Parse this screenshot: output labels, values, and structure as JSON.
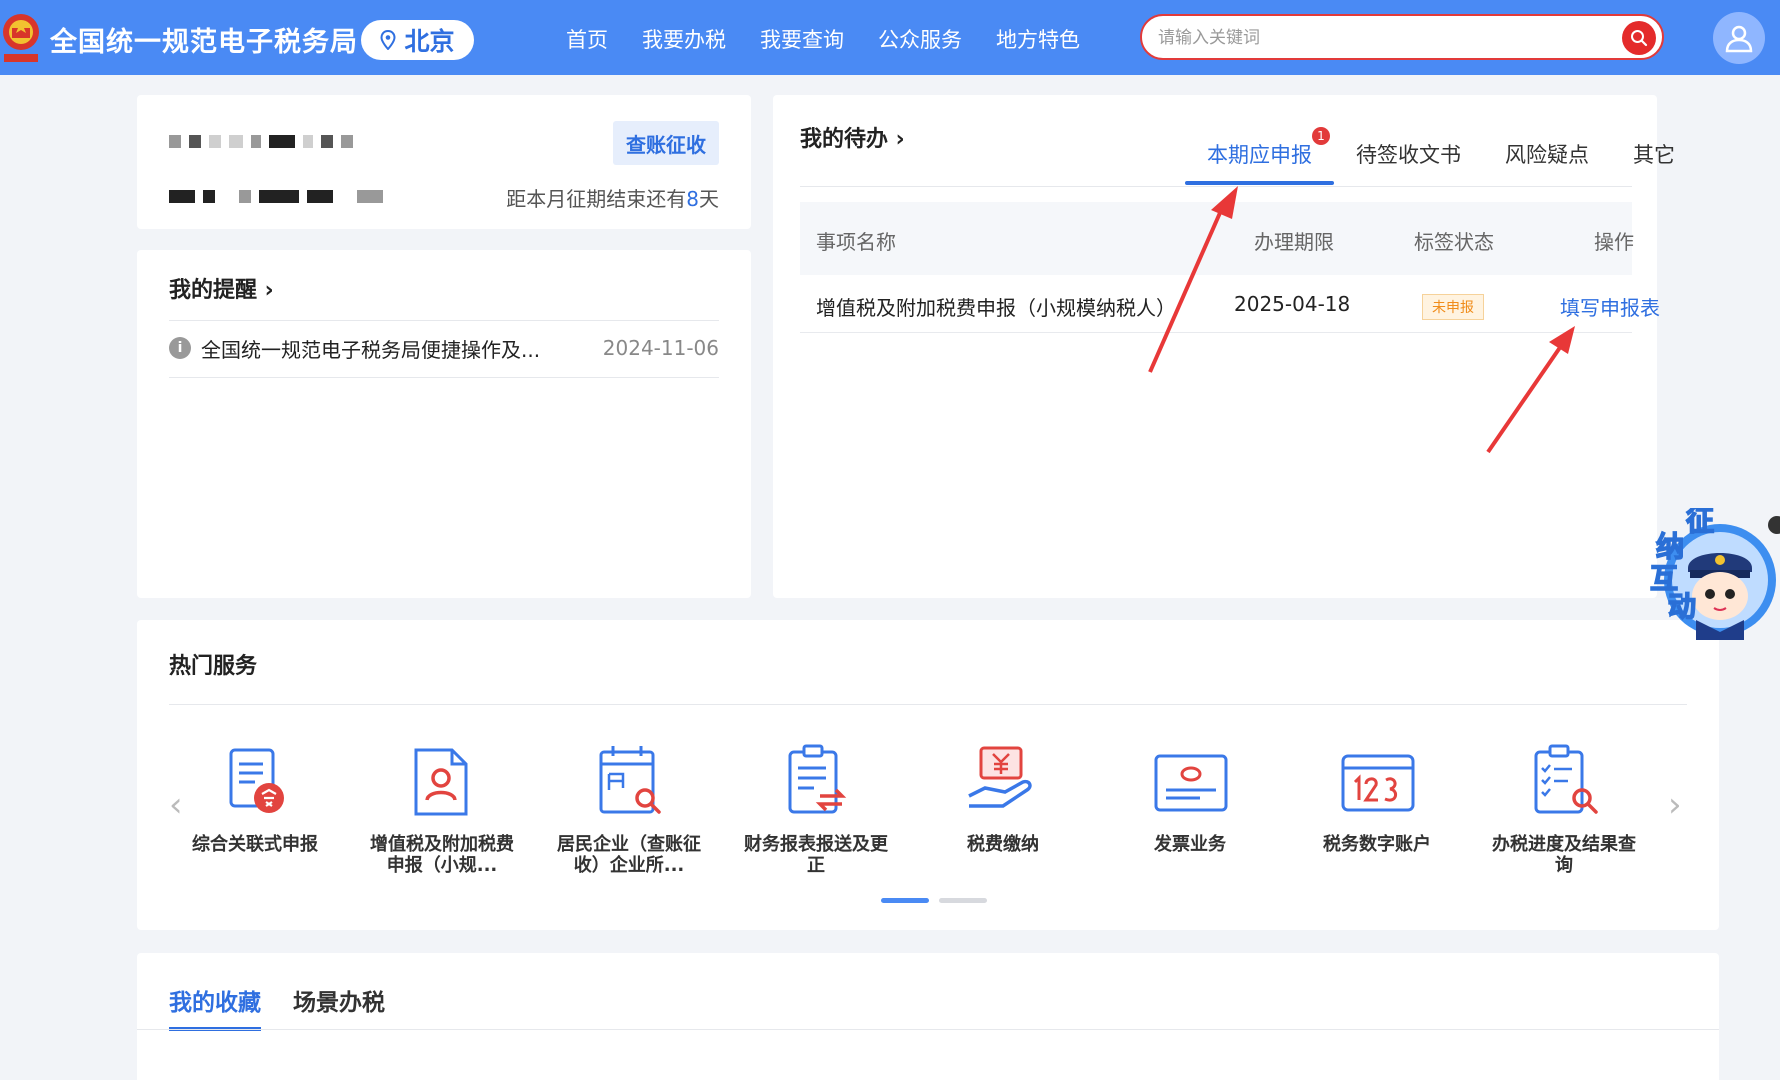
{
  "header": {
    "site_title": "全国统一规范电子税务局",
    "city": "北京",
    "nav": [
      "首页",
      "我要办税",
      "我要查询",
      "公众服务",
      "地方特色"
    ],
    "search_placeholder": "请输入关键词",
    "colors": {
      "header_bg": "#4a8af4",
      "search_border": "#e23a3a"
    }
  },
  "account": {
    "mode_button": "查账征收",
    "period_prefix": "距本月征期结束还有",
    "period_days": "8",
    "period_suffix": "天"
  },
  "reminder": {
    "title": "我的提醒",
    "items": [
      {
        "text": "全国统一规范电子税务局便捷操作及...",
        "date": "2024-11-06"
      }
    ]
  },
  "todo": {
    "title": "我的待办",
    "tabs": [
      {
        "label": "本期应申报",
        "badge": "1"
      },
      {
        "label": "待签收文书"
      },
      {
        "label": "风险疑点"
      },
      {
        "label": "其它"
      }
    ],
    "columns": [
      "事项名称",
      "办理期限",
      "标签状态",
      "操作"
    ],
    "rows": [
      {
        "name": "增值税及附加税费申报（小规模纳税人）",
        "deadline": "2025-04-18",
        "status": "未申报",
        "action": "填写申报表"
      }
    ]
  },
  "hot_services": {
    "title": "热门服务",
    "items": [
      {
        "label": "综合关联式申报",
        "icon": "document-composite-icon"
      },
      {
        "label": "增值税及附加税费申报（小规...",
        "icon": "document-person-icon"
      },
      {
        "label": "居民企业（查账征收）企业所...",
        "icon": "calendar-search-icon"
      },
      {
        "label": "财务报表报送及更正",
        "icon": "clipboard-exchange-icon"
      },
      {
        "label": "税费缴纳",
        "icon": "hand-yuan-icon"
      },
      {
        "label": "发票业务",
        "icon": "invoice-icon"
      },
      {
        "label": "税务数字账户",
        "icon": "digital-account-icon"
      },
      {
        "label": "办税进度及结果查询",
        "icon": "checklist-search-icon"
      }
    ],
    "page": 1,
    "pages": 2
  },
  "favorites": {
    "tabs": [
      "我的收藏",
      "场景办税"
    ]
  },
  "assistant": {
    "label_chars": [
      "征",
      "纳",
      "互",
      "动"
    ]
  }
}
